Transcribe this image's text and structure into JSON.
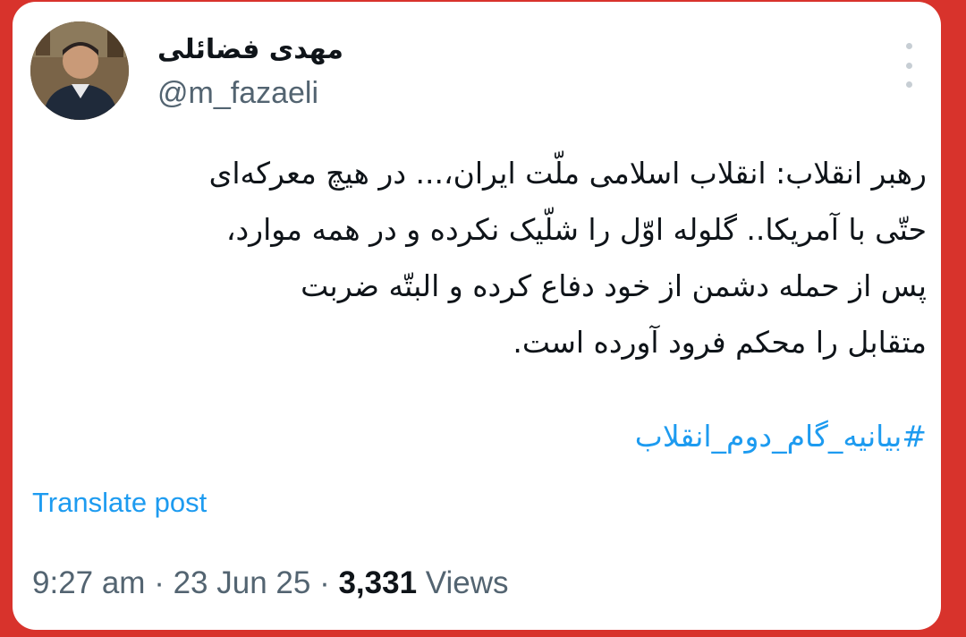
{
  "author": {
    "display_name": "مهدی فضائلی",
    "handle": "@m_fazaeli"
  },
  "tweet": {
    "lines": [
      "رهبر انقلاب: انقلاب اسلامی ملّت ایران،... در هیچ معرکه‌ای",
      "حتّی با آمریکا.. گلوله اوّل را شلّیک نکرده و در همه موارد،",
      "پس از حمله دشمن از خود دفاع کرده و البتّه ضربت",
      "متقابل را محکم فرود آورده است."
    ],
    "hashtag": "#بیانیه_گام_دوم_انقلاب",
    "translate_label": "Translate post"
  },
  "meta": {
    "time": "9:27 am",
    "separator": "·",
    "date": "23 Jun 25",
    "views_count": "3,331",
    "views_label": "Views"
  },
  "icons": {
    "more": "more-vertical-icon",
    "avatar": "profile-photo"
  },
  "colors": {
    "frame": "#d8332c",
    "link": "#1d9bf0",
    "secondary_text": "#536471",
    "primary_text": "#0f1419"
  }
}
